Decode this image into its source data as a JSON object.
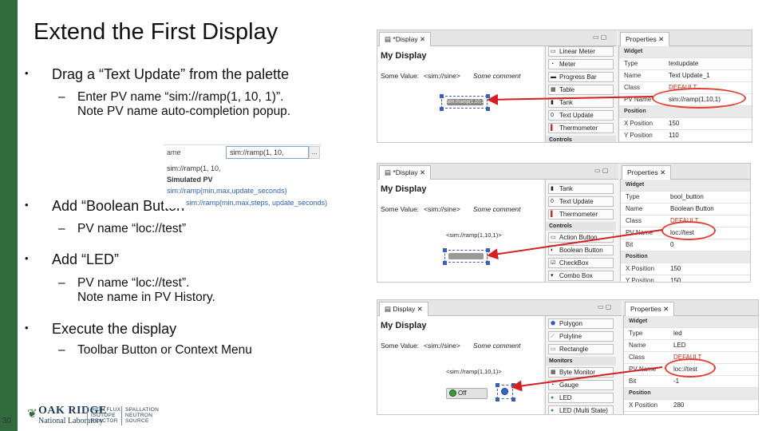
{
  "slide": {
    "title": "Extend the First Display",
    "page_number": "30",
    "colors": {
      "sidebar": "#2f6b3c",
      "arrow": "#d42020"
    },
    "bullets": [
      {
        "text": "Drag a “Text Update” from the palette",
        "subs": [
          "Enter PV name “sim://ramp(1, 10, 1)”.",
          "Note PV name auto-completion popup."
        ]
      },
      {
        "text": "Add “Boolean Button”",
        "subs": [
          "PV name “loc://test”"
        ]
      },
      {
        "text": "Add “LED”",
        "subs": [
          "PV name “loc://test”.",
          "Note name in PV History."
        ]
      },
      {
        "text": "Execute the display",
        "subs": [
          "Toolbar Button or Context Menu"
        ]
      }
    ]
  },
  "logo": {
    "name": "OAK RIDGE",
    "sub": "National Laboratory",
    "reactor": [
      "HIGH FLUX",
      "ISOTOPE",
      "REACTOR"
    ],
    "spallation": [
      "SPALLATION",
      "NEUTRON",
      "SOURCE"
    ]
  },
  "popup": {
    "label": "ame",
    "input": "sim://ramp(1, 10,",
    "more": "...",
    "history": "sim://ramp(1, 10,",
    "section": "Simulated PV",
    "suggestions": [
      "sim://ramp(min,max,update_seconds)",
      "sim://ramp(min,max,steps, update_seconds)"
    ]
  },
  "shot1": {
    "display_tab": "*Display",
    "props_tab": "Properties",
    "my_display": "My Display",
    "some_value": "Some Value:",
    "pv": "<sim://sine>",
    "comment": "Some comment",
    "widget_label": "sim://ramp(1,10,1)",
    "palette": [
      "Linear Meter",
      "Meter",
      "Progress Bar",
      "Table",
      "Tank",
      "Text Update",
      "Thermometer"
    ],
    "palette_section": "Controls",
    "props": [
      {
        "k": "Widget",
        "v": "",
        "sec": true
      },
      {
        "k": "Type",
        "v": "textupdate"
      },
      {
        "k": "Name",
        "v": "Text Update_1"
      },
      {
        "k": "Class",
        "v": "DEFAULT"
      },
      {
        "k": "PV Name",
        "v": "sim://ramp(1,10,1)",
        "hl": true
      },
      {
        "k": "Position",
        "v": "",
        "sec": true
      },
      {
        "k": "X Position",
        "v": "150"
      },
      {
        "k": "Y Position",
        "v": "110"
      }
    ]
  },
  "shot2": {
    "display_tab": "*Display",
    "props_tab": "Properties",
    "my_display": "My Display",
    "some_value": "Some Value:",
    "pv": "<sim://sine>",
    "comment": "Some comment",
    "textupdate": "<sim://ramp(1,10,1)>",
    "palette": [
      "Tank",
      "Text Update",
      "Thermometer",
      "Action Button",
      "Boolean Button",
      "CheckBox",
      "Combo Box"
    ],
    "palette_section": "Controls",
    "props": [
      {
        "k": "Widget",
        "v": "",
        "sec": true
      },
      {
        "k": "Type",
        "v": "bool_button"
      },
      {
        "k": "Name",
        "v": "Boolean Button"
      },
      {
        "k": "Class",
        "v": "DEFAULT"
      },
      {
        "k": "PV Name",
        "v": "loc://test",
        "hl": true
      },
      {
        "k": "Bit",
        "v": "0"
      },
      {
        "k": "Position",
        "v": "",
        "sec": true
      },
      {
        "k": "X Position",
        "v": "150"
      },
      {
        "k": "Y Position",
        "v": "150"
      }
    ]
  },
  "shot3": {
    "display_tab": "Display",
    "props_tab": "Properties",
    "my_display": "My Display",
    "some_value": "Some Value:",
    "pv": "<sim://sine>",
    "comment": "Some comment",
    "textupdate": "<sim://ramp(1,10,1)>",
    "button": "Off",
    "palette": [
      "Polygon",
      "Polyline",
      "Rectangle",
      "Byte Monitor",
      "Gauge",
      "LED",
      "LED (Multi State)"
    ],
    "palette_section": "Monitors",
    "props": [
      {
        "k": "Widget",
        "v": "",
        "sec": true
      },
      {
        "k": "Type",
        "v": "led"
      },
      {
        "k": "Name",
        "v": "LED"
      },
      {
        "k": "Class",
        "v": "DEFAULT"
      },
      {
        "k": "PV Name",
        "v": "loc://test",
        "hl": true
      },
      {
        "k": "Bit",
        "v": "-1"
      },
      {
        "k": "Position",
        "v": "",
        "sec": true
      },
      {
        "k": "X Position",
        "v": "280"
      }
    ]
  }
}
